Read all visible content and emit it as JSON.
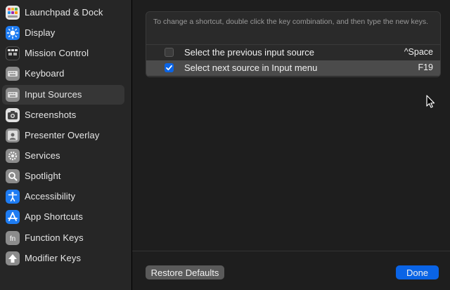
{
  "sidebar": {
    "items": [
      {
        "label": "Launchpad & Dock",
        "icon": "launchpad-dock-icon",
        "color": "#e8e8e8"
      },
      {
        "label": "Display",
        "icon": "display-brightness-icon",
        "color": "#1e7cf2"
      },
      {
        "label": "Mission Control",
        "icon": "mission-control-icon",
        "color": "#222222"
      },
      {
        "label": "Keyboard",
        "icon": "keyboard-icon",
        "color": "#8c8c8c"
      },
      {
        "label": "Input Sources",
        "icon": "input-sources-icon",
        "color": "#8c8c8c"
      },
      {
        "label": "Screenshots",
        "icon": "screenshot-camera-icon",
        "color": "#e0e0e0"
      },
      {
        "label": "Presenter Overlay",
        "icon": "presenter-overlay-icon",
        "color": "#8c8c8c"
      },
      {
        "label": "Services",
        "icon": "gear-icon",
        "color": "#8c8c8c"
      },
      {
        "label": "Spotlight",
        "icon": "magnifying-glass-icon",
        "color": "#8c8c8c"
      },
      {
        "label": "Accessibility",
        "icon": "accessibility-icon",
        "color": "#1e7cf2"
      },
      {
        "label": "App Shortcuts",
        "icon": "app-store-icon",
        "color": "#1e7cf2"
      },
      {
        "label": "Function Keys",
        "icon": "fn-key-icon",
        "color": "#8c8c8c"
      },
      {
        "label": "Modifier Keys",
        "icon": "up-arrow-icon",
        "color": "#8c8c8c"
      }
    ],
    "selected": "Input Sources"
  },
  "panel": {
    "instructions": "To change a shortcut, double click the key combination, and then type the new keys.",
    "shortcuts": [
      {
        "label": "Select the previous input source",
        "key": "^Space",
        "checked": false
      },
      {
        "label": "Select next source in Input menu",
        "key": "F19",
        "checked": true
      }
    ]
  },
  "buttons": {
    "restore": "Restore Defaults",
    "done": "Done"
  },
  "colors": {
    "accent": "#0a64e6",
    "sidebar_bg": "#262626",
    "window_bg": "#1e1e1e"
  }
}
